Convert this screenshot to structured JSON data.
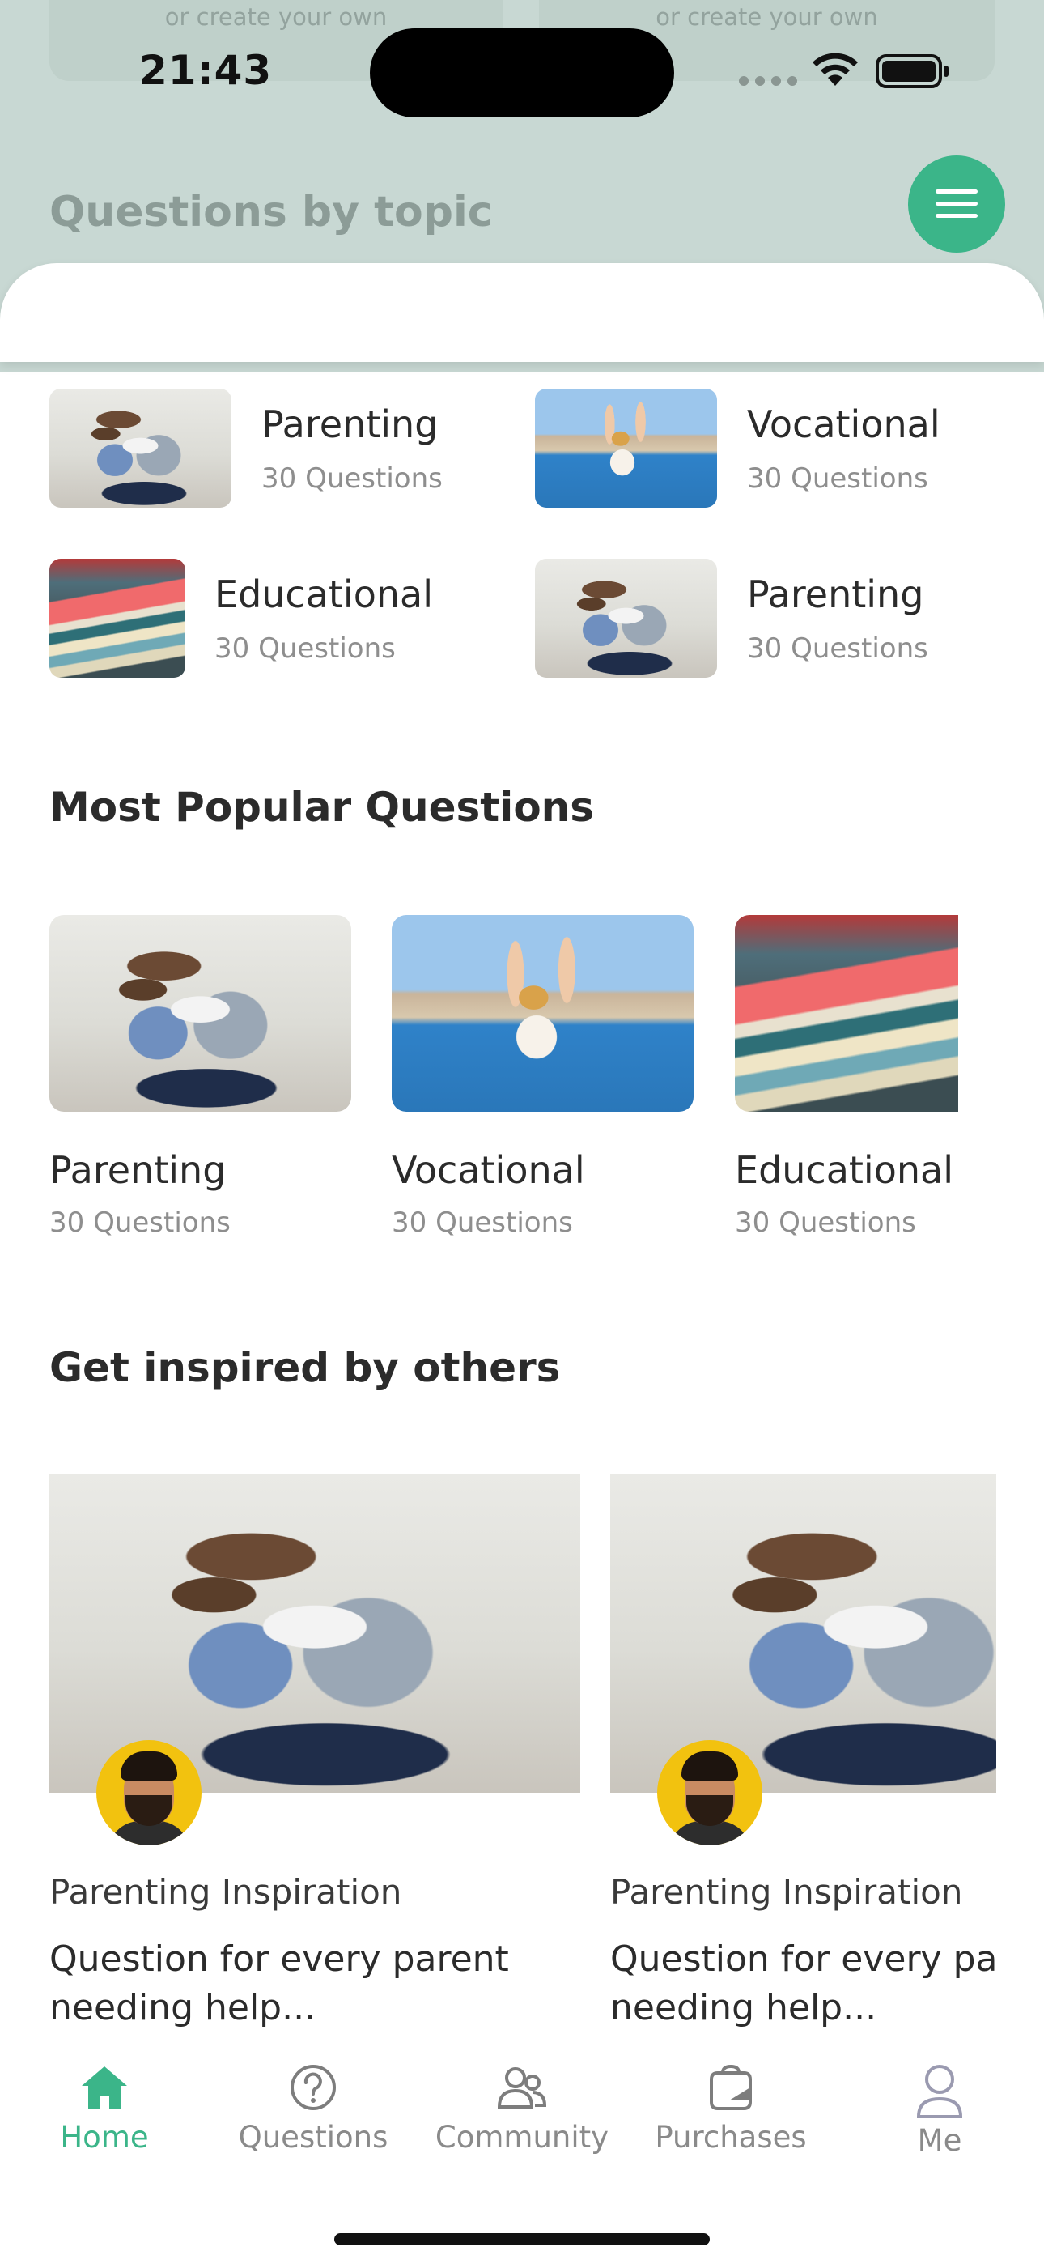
{
  "status_bar": {
    "time": "21:43"
  },
  "header": {
    "ghost_cards": [
      {
        "text": "or create your own"
      },
      {
        "text": "or create your own"
      }
    ],
    "title": "Questions by topic",
    "menu_icon": "hamburger-menu-icon",
    "accent_color": "#3bb589"
  },
  "topics": [
    {
      "title": "Parenting",
      "count": "30 Questions",
      "image": "family-reading"
    },
    {
      "title": "Vocational",
      "count": "30 Questions",
      "image": "beach-woman"
    },
    {
      "title": "Educational",
      "count": "30 Questions",
      "image": "book-stack"
    },
    {
      "title": "Parenting",
      "count": "30 Questions",
      "image": "family-reading"
    }
  ],
  "popular": {
    "heading": "Most Popular Questions",
    "items": [
      {
        "title": "Parenting",
        "count": "30 Questions",
        "image": "family-reading"
      },
      {
        "title": "Vocational",
        "count": "30 Questions",
        "image": "beach-woman"
      },
      {
        "title": "Educational",
        "count": "30 Questions",
        "image": "book-stack"
      }
    ]
  },
  "inspired": {
    "heading": "Get inspired by others",
    "cards": [
      {
        "category": "Parenting Inspiration",
        "text": "Question for every parent needing help..."
      },
      {
        "category": "Parenting Inspiration",
        "text": "Question for every parent needing help..."
      }
    ]
  },
  "nav": {
    "items": [
      {
        "label": "Home",
        "icon": "home-icon",
        "active": true
      },
      {
        "label": "Questions",
        "icon": "question-circle-icon",
        "active": false
      },
      {
        "label": "Community",
        "icon": "community-icon",
        "active": false
      },
      {
        "label": "Purchases",
        "icon": "purchases-icon",
        "active": false
      },
      {
        "label": "Me",
        "icon": "user-icon",
        "active": false
      }
    ]
  }
}
